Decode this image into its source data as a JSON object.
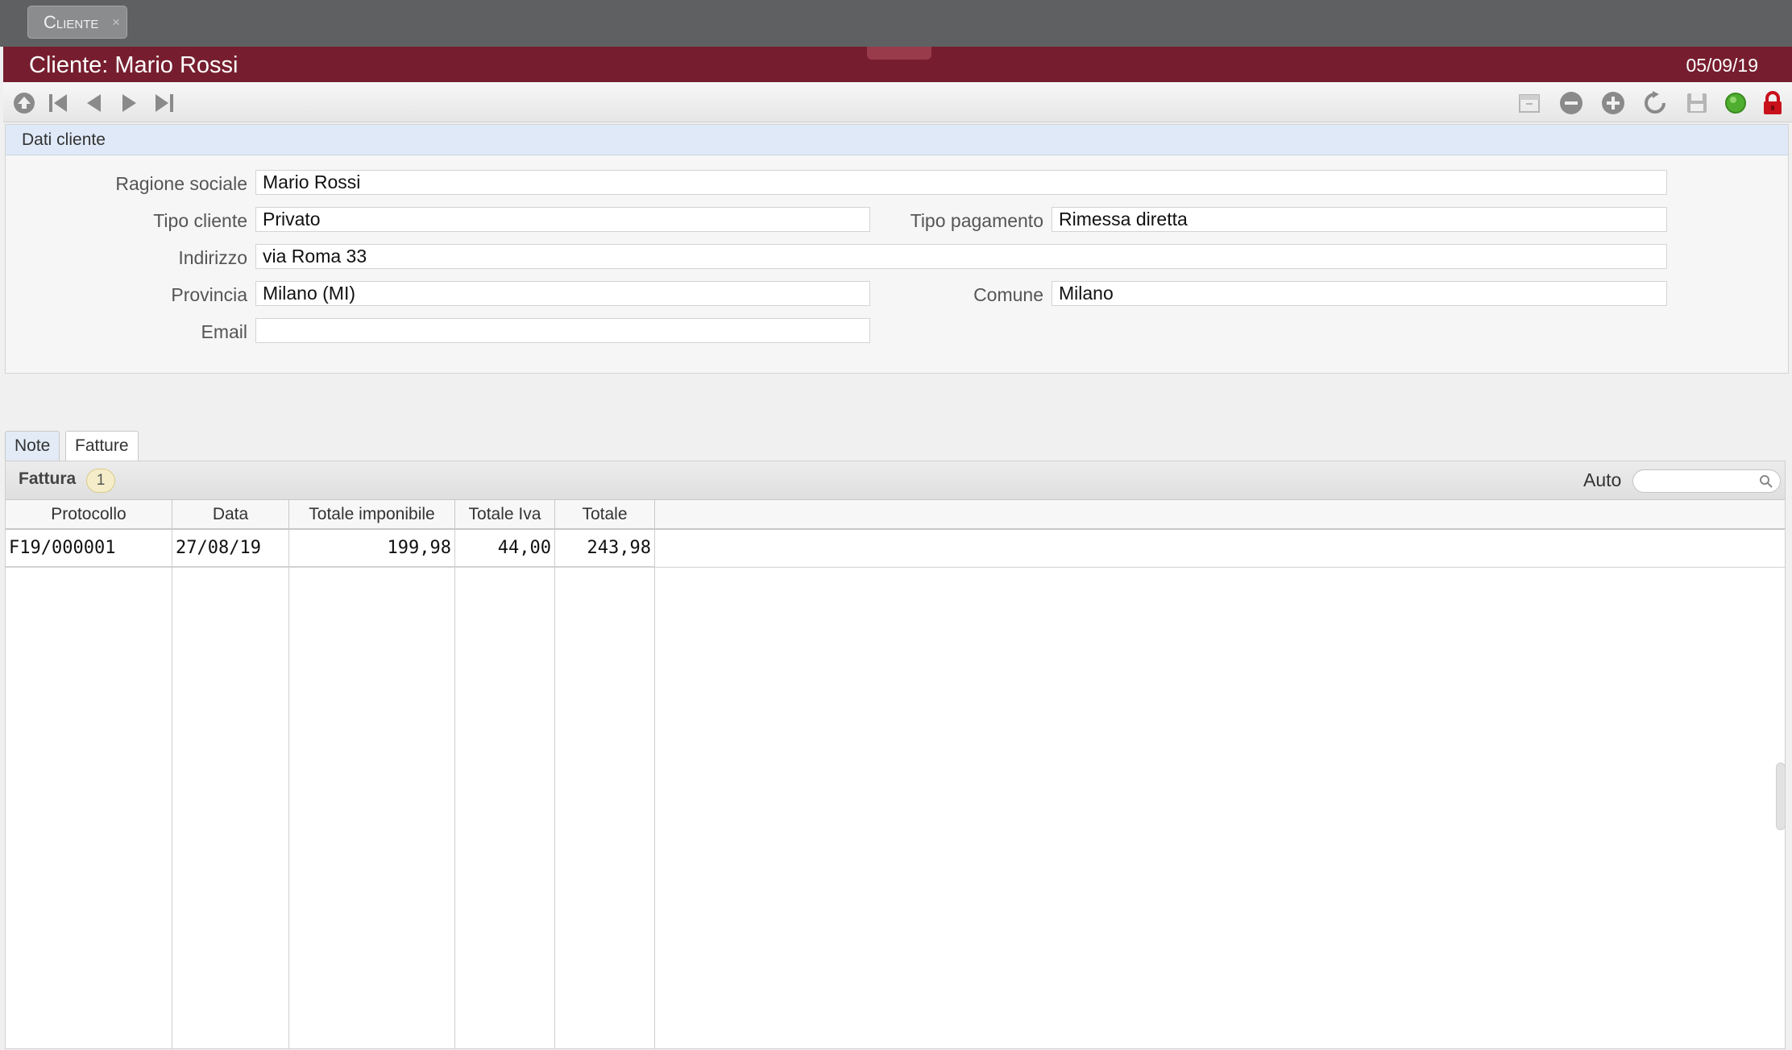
{
  "window_tab": {
    "label": "Cliente",
    "close": "×"
  },
  "header": {
    "title": "Cliente: Mario Rossi",
    "date": "05/09/19"
  },
  "toolbar": {
    "left_icons": [
      "upload-icon",
      "first-record-icon",
      "previous-record-icon",
      "next-record-icon",
      "last-record-icon"
    ],
    "right_icons": [
      "archive-icon",
      "remove-icon",
      "add-icon",
      "refresh-icon",
      "save-icon",
      "status-icon",
      "lock-icon"
    ],
    "status_color": "#4fae2f",
    "lock_color": "#c8111b"
  },
  "form": {
    "section_title": "Dati cliente",
    "fields": {
      "ragione_sociale": {
        "label": "Ragione sociale",
        "value": "Mario Rossi"
      },
      "tipo_cliente": {
        "label": "Tipo cliente",
        "value": "Privato"
      },
      "tipo_pagamento": {
        "label": "Tipo pagamento",
        "value": "Rimessa diretta"
      },
      "indirizzo": {
        "label": "Indirizzo",
        "value": "via Roma 33"
      },
      "provincia": {
        "label": "Provincia",
        "value": "Milano (MI)"
      },
      "comune": {
        "label": "Comune",
        "value": "Milano"
      },
      "email": {
        "label": "Email",
        "value": ""
      }
    }
  },
  "subtabs": {
    "note": "Note",
    "fatture": "Fatture"
  },
  "grid": {
    "title": "Fattura",
    "count": "1",
    "auto_label": "Auto",
    "search_placeholder": "",
    "columns": [
      "Protocollo",
      "Data",
      "Totale imponibile",
      "Totale Iva",
      "Totale"
    ],
    "rows": [
      {
        "protocollo": "F19/000001",
        "data": "27/08/19",
        "imponibile": "199,98",
        "iva": "44,00",
        "totale": "243,98"
      }
    ]
  },
  "colors": {
    "brand": "#761e2f",
    "form_header": "#dfe9f7"
  }
}
